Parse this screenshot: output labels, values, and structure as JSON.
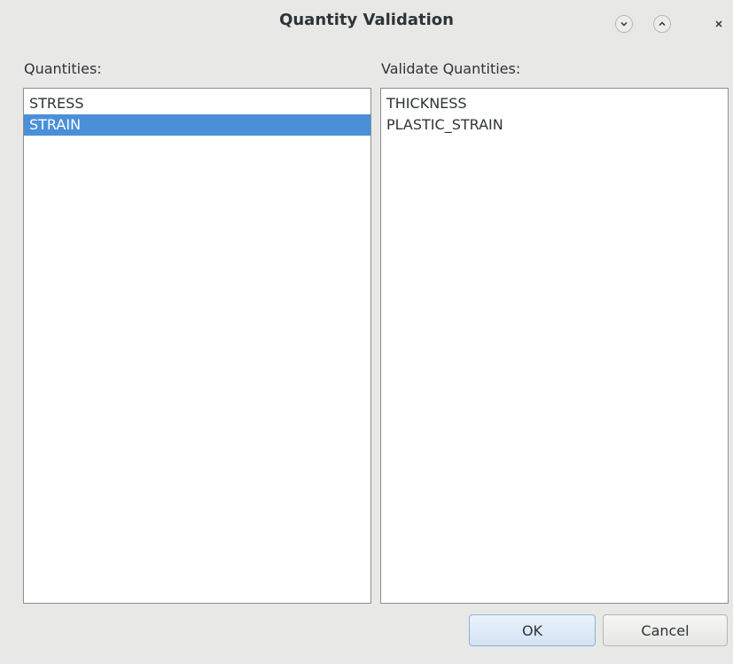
{
  "window": {
    "title": "Quantity Validation",
    "controls": {
      "minimize_icon": "chevron-down-icon",
      "maximize_icon": "chevron-up-icon",
      "close_icon": "close-icon"
    }
  },
  "quantities": {
    "label": "Quantities:",
    "items": [
      {
        "label": "STRESS",
        "selected": false
      },
      {
        "label": "STRAIN",
        "selected": true
      }
    ]
  },
  "validate": {
    "label": "Validate Quantities:",
    "items": [
      {
        "label": "THICKNESS"
      },
      {
        "label": "PLASTIC_STRAIN"
      }
    ]
  },
  "buttons": {
    "ok": "OK",
    "cancel": "Cancel"
  },
  "colors": {
    "selection": "#4a90d9",
    "background": "#e8e8e7"
  }
}
